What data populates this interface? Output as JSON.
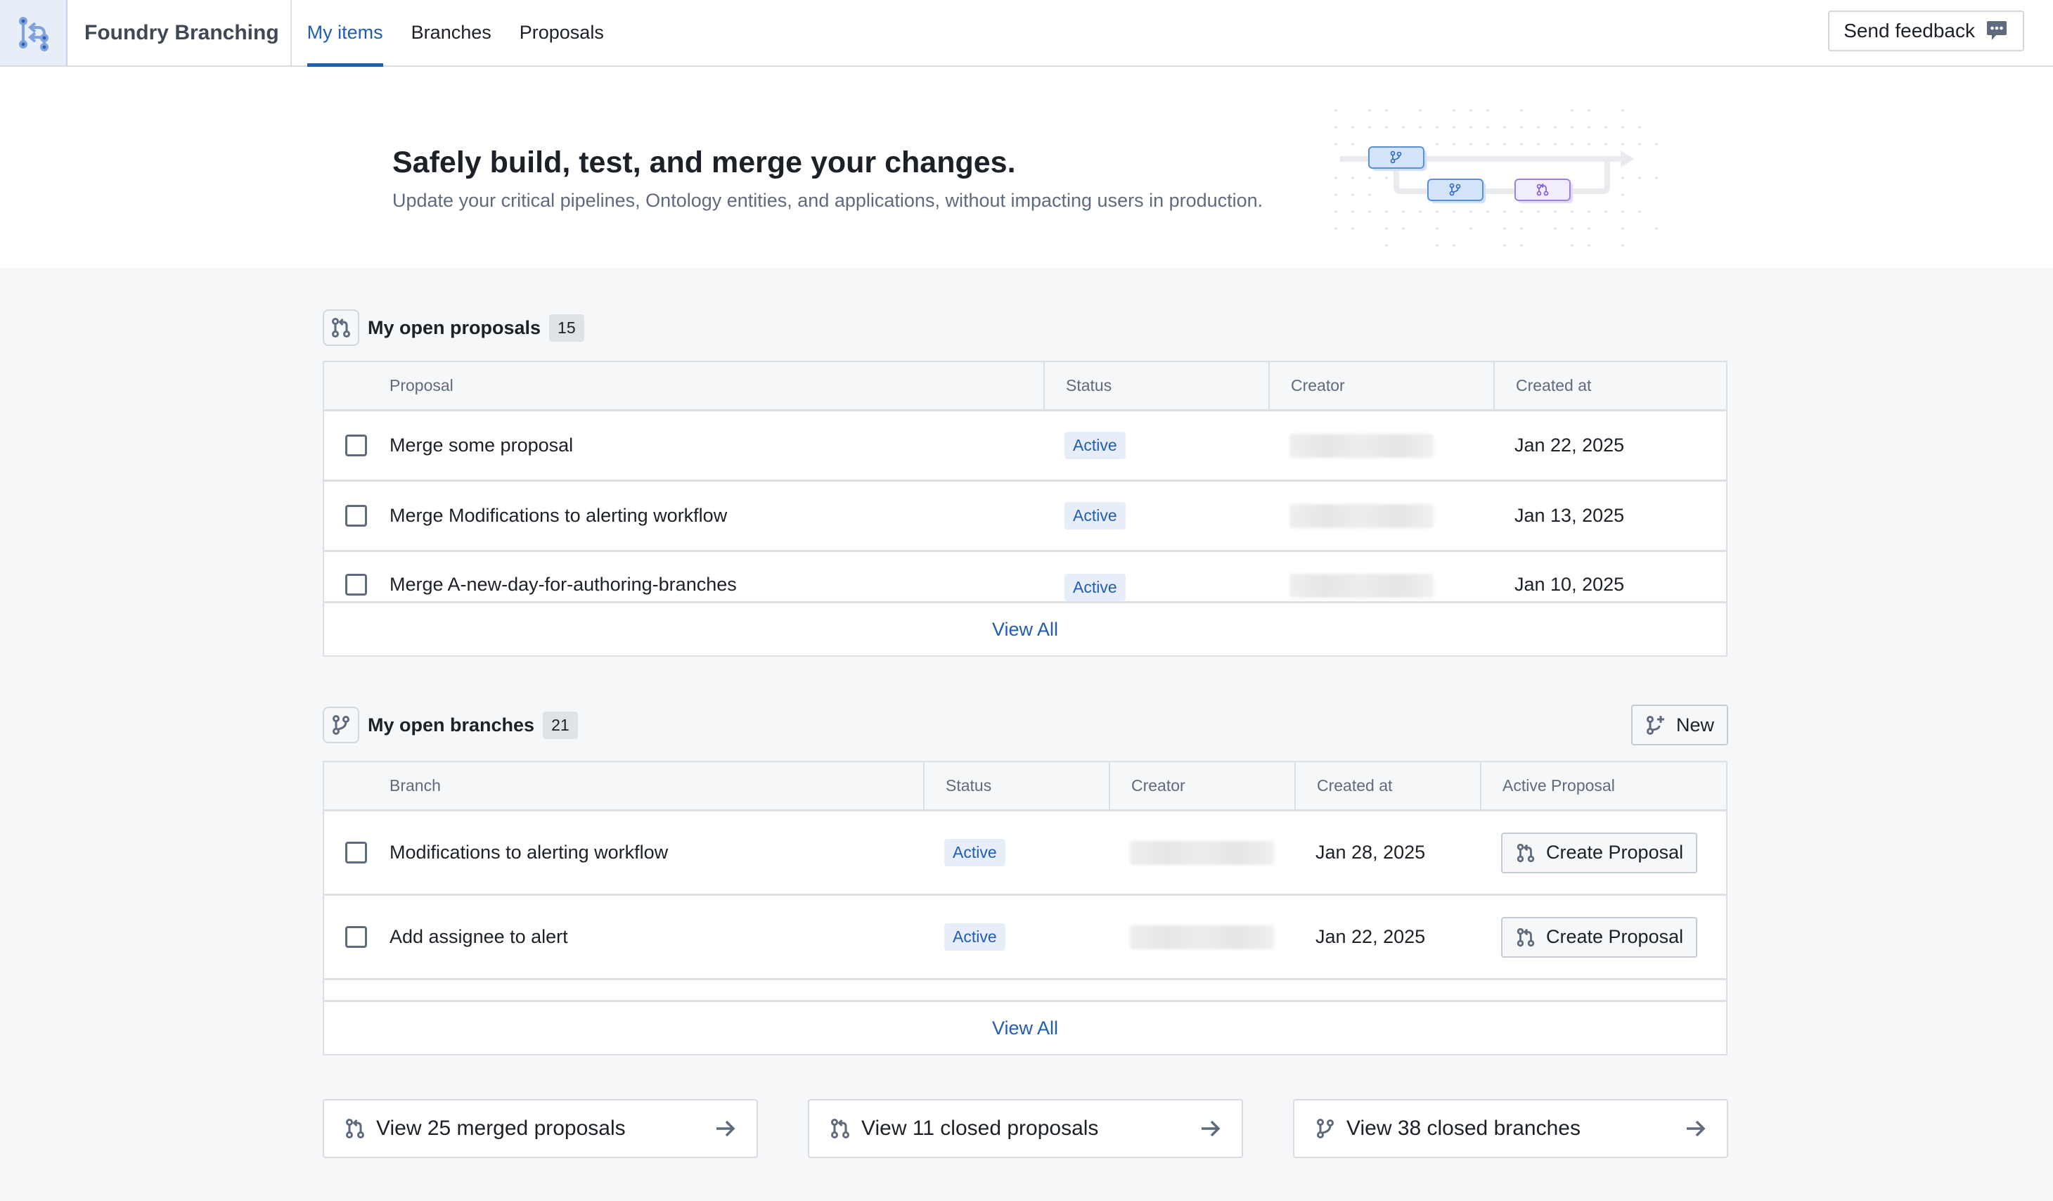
{
  "navbar": {
    "logo_icon": "branching-logo-icon",
    "brand": "Foundry Branching",
    "tabs": [
      {
        "label": "My items",
        "active": true
      },
      {
        "label": "Branches",
        "active": false
      },
      {
        "label": "Proposals",
        "active": false
      }
    ],
    "feedback_label": "Send feedback",
    "feedback_icon": "comment-icon"
  },
  "hero": {
    "title": "Safely build, test, and merge your changes.",
    "subtitle": "Update your critical pipelines, Ontology entities, and applications, without impacting users in production."
  },
  "proposals": {
    "title": "My open proposals",
    "count": "15",
    "icon": "git-pull-icon",
    "columns": [
      "Proposal",
      "Status",
      "Creator",
      "Created at"
    ],
    "rows": [
      {
        "name": "Merge some proposal",
        "status": "Active",
        "creator": "[redacted]",
        "created_at": "Jan 22, 2025"
      },
      {
        "name": "Merge Modifications to alerting workflow",
        "status": "Active",
        "creator": "[redacted]",
        "created_at": "Jan 13, 2025"
      },
      {
        "name": "Merge A-new-day-for-authoring-branches",
        "status": "Active",
        "creator": "[redacted]",
        "created_at": "Jan 10, 2025"
      }
    ],
    "view_all": "View All"
  },
  "branches": {
    "title": "My open branches",
    "count": "21",
    "icon": "git-branch-icon",
    "new_label": "New",
    "columns": [
      "Branch",
      "Status",
      "Creator",
      "Created at",
      "Active Proposal"
    ],
    "rows": [
      {
        "name": "Modifications to alerting workflow",
        "status": "Active",
        "creator": "[redacted]",
        "created_at": "Jan 28, 2025",
        "action": "Create Proposal"
      },
      {
        "name": "Add assignee to alert",
        "status": "Active",
        "creator": "[redacted]",
        "created_at": "Jan 22, 2025",
        "action": "Create Proposal"
      }
    ],
    "view_all": "View All"
  },
  "footer_links": [
    {
      "label": "View 25 merged proposals",
      "icon": "git-pull-icon"
    },
    {
      "label": "View 11 closed proposals",
      "icon": "git-pull-icon"
    },
    {
      "label": "View 38 closed branches",
      "icon": "git-branch-icon"
    }
  ],
  "colors": {
    "accent": "#215db0",
    "status_bg": "#e7eef9",
    "muted_text": "#5f6b7c",
    "illustration_branch": "#4a82d4",
    "illustration_proposal": "#8f6fe0"
  }
}
